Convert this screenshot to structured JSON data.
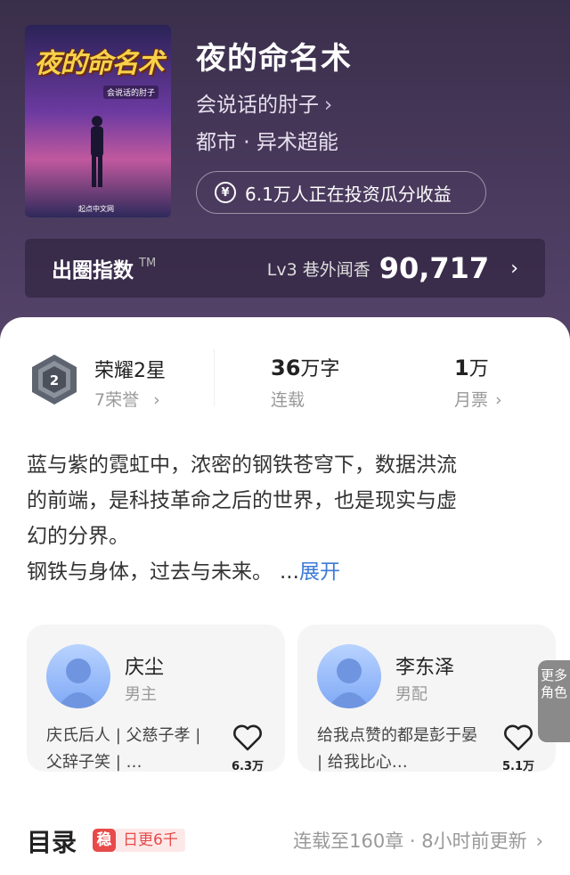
{
  "book": {
    "cover_title": "夜的命名术",
    "cover_author": "会说话的肘子",
    "cover_publisher": "起点中文网",
    "title": "夜的命名术",
    "author": "会说话的肘子",
    "genre": "都市 · 异术超能",
    "invest_text": "6.1万人正在投资瓜分收益"
  },
  "chuquan": {
    "label": "出圈指数",
    "tm": "TM",
    "level": "Lv3 巷外闻香",
    "value": "90,717"
  },
  "stats": {
    "honor_title": "荣耀2星",
    "honor_sub": "7荣誉",
    "words_num": "36",
    "words_unit": "万字",
    "words_label": "连载",
    "tickets_num": "1",
    "tickets_unit": "万",
    "tickets_label": "月票"
  },
  "description": {
    "text": "蓝与紫的霓虹中，浓密的钢铁苍穹下，数据洪流的前端，是科技革命之后的世界，也是现实与虚幻的分界。钢铁与身体，过去与未来。",
    "line1": "蓝与紫的霓虹中，浓密的钢铁苍穹下，数据洪流",
    "line2": "的前端，是科技革命之后的世界，也是现实与虚",
    "line3": "幻的分界。",
    "line4": "钢铁与身体，过去与未来。",
    "ellipsis": "...",
    "more": "展开"
  },
  "characters": [
    {
      "name": "庆尘",
      "role": "男主",
      "bio": "庆氏后人 | 父慈子孝 | 父辞子笑 | …",
      "likes": "6.3万"
    },
    {
      "name": "李东泽",
      "role": "男配",
      "bio": "给我点赞的都是彭于晏 | 给我比心…",
      "likes": "5.1万"
    }
  ],
  "more_characters": "更多角色",
  "toc": {
    "title": "目录",
    "daily_icon": "稳",
    "daily_text": "日更6千",
    "update": "连载至160章 · 8小时前更新"
  },
  "icons": {
    "yen": "yen-coin-icon",
    "chevron": "chevron-right-icon",
    "heart": "heart-icon",
    "badge": "honor-badge-icon"
  },
  "colors": {
    "accent_link": "#3d7ad8",
    "tag_red": "#e84a4a",
    "hero_bg": "#4a3a5e"
  }
}
